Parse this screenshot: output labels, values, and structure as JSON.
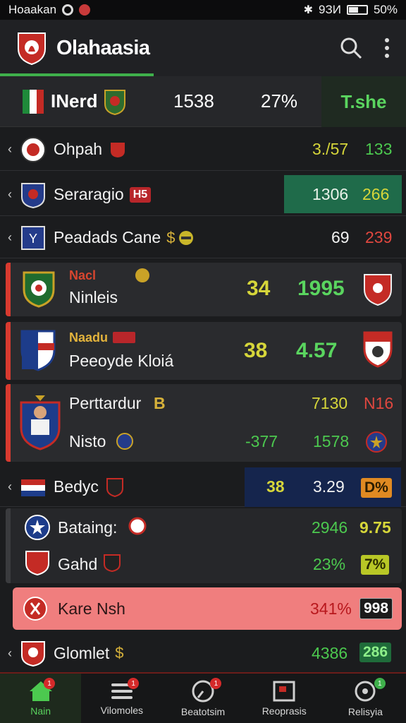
{
  "status_bar": {
    "left_text": "Hoaakan",
    "signal_text": "9ЗИ",
    "battery": "50%"
  },
  "app_bar": {
    "title": "Olahaasia"
  },
  "summary": {
    "name": "INerd",
    "value1": "1538",
    "value2": "27%",
    "tab": "T.she"
  },
  "rows": [
    {
      "label": "Ohpah",
      "v1": "3./57",
      "v2": "133"
    },
    {
      "label": "Seraragio",
      "tag": "H5",
      "v1": "1306",
      "v2": "266"
    },
    {
      "label": "Peadads Cane",
      "tag": "$",
      "v1": "69",
      "v2": "239"
    }
  ],
  "card1": {
    "subtitle": "Nacl",
    "label": "Ninleis",
    "v1": "34",
    "v2": "1995"
  },
  "card2": {
    "subtitle": "Naadu",
    "label": "Peeoyde Kloiá",
    "v1": "38",
    "v2": "4.57"
  },
  "card3": {
    "label1": "Perttardur",
    "tag": "B",
    "label2": "Nisto",
    "v1": "7130",
    "v2": "N16",
    "v3": "-377",
    "v4": "1578"
  },
  "row_beyc": {
    "label": "Bedyc",
    "v1": "38",
    "v2": "3.29",
    "v3": "D%"
  },
  "card4": {
    "label1": "Bataing:",
    "label2": "Gahd",
    "v1": "2946",
    "v2": "9.75",
    "v3": "23%",
    "v4": "7%"
  },
  "highlight_row": {
    "label": "Kare Nsh",
    "v1": "341%",
    "v2": "998"
  },
  "last_row": {
    "label": "Glomlet",
    "tag": "$",
    "v1": "4386",
    "v2": "286"
  },
  "bottom_nav": [
    {
      "label": "Nain",
      "badge": "1"
    },
    {
      "label": "Vilomoles",
      "badge": "1"
    },
    {
      "label": "Beatotsim",
      "badge": "1"
    },
    {
      "label": "Reoprasis",
      "badge": ""
    },
    {
      "label": "Relisyia",
      "badge": "1"
    }
  ],
  "colors": {
    "accent_green": "#3fb04b",
    "accent_red": "#d83a2f",
    "yellow": "#d6d63a",
    "highlight": "#f07e7e"
  }
}
